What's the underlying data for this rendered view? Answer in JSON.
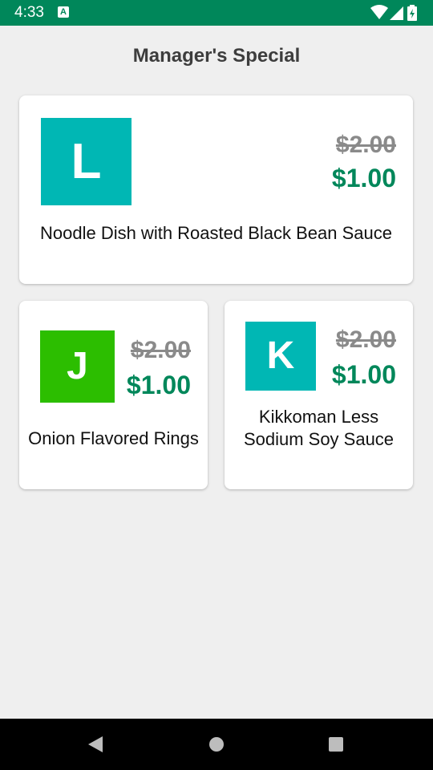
{
  "status_bar": {
    "time": "4:33",
    "notification_icon": "a-icon",
    "icons": [
      "wifi-icon",
      "signal-icon",
      "battery-icon"
    ]
  },
  "page": {
    "title": "Manager's Special"
  },
  "specials": [
    {
      "tile_letter": "L",
      "tile_color": "#00b7b4",
      "original_price": "$2.00",
      "sale_price": "$1.00",
      "name": "Noodle Dish with Roasted Black Bean Sauce"
    },
    {
      "tile_letter": "J",
      "tile_color": "#2cbe00",
      "original_price": "$2.00",
      "sale_price": "$1.00",
      "name": "Onion Flavored Rings"
    },
    {
      "tile_letter": "K",
      "tile_color": "#00b7b4",
      "original_price": "$2.00",
      "sale_price": "$1.00",
      "name": "Kikkoman Less Sodium Soy Sauce"
    }
  ],
  "nav_bar": {
    "buttons": [
      "back-icon",
      "home-icon",
      "recents-icon"
    ]
  },
  "colors": {
    "status_bar": "#00875a",
    "sale_price": "#00875a",
    "original_price": "#8a8a8a",
    "background": "#efefef"
  }
}
